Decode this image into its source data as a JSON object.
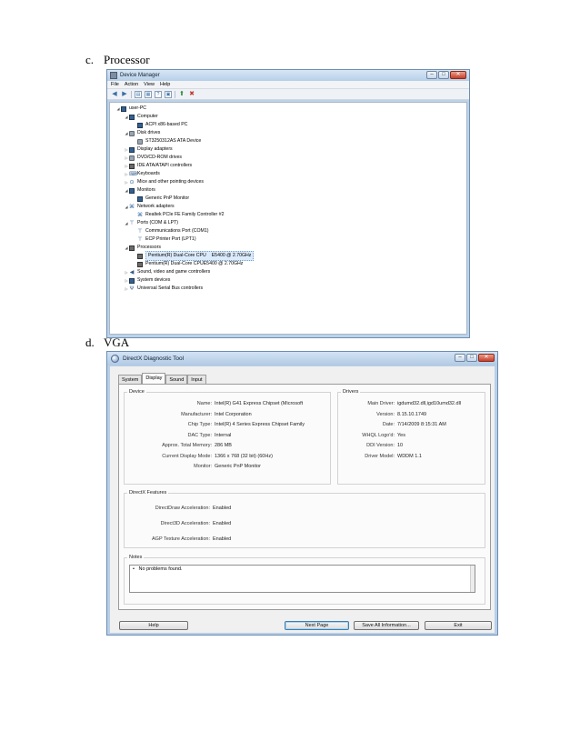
{
  "section_c": {
    "letter": "c.",
    "title": "Processor"
  },
  "section_d": {
    "letter": "d.",
    "title": "VGA"
  },
  "device_manager": {
    "window_title": "Device Manager",
    "menu": [
      "File",
      "Action",
      "View",
      "Help"
    ],
    "toolbar_icons": [
      "back-icon",
      "forward-icon",
      "properties-icon",
      "help-icon",
      "scan-icon",
      "update-driver-icon",
      "uninstall-icon"
    ],
    "tree": [
      {
        "label": "user-PC",
        "level": 0,
        "expander": "◢",
        "icon": "computer-icon"
      },
      {
        "label": "Computer",
        "level": 1,
        "expander": "◢",
        "icon": "monitor-icon"
      },
      {
        "label": "ACPI x86-based PC",
        "level": 2,
        "expander": "",
        "icon": "monitor-icon"
      },
      {
        "label": "Disk drives",
        "level": 1,
        "expander": "◢",
        "icon": "disk-icon"
      },
      {
        "label": "ST3250312AS ATA Device",
        "level": 2,
        "expander": "",
        "icon": "disk-icon"
      },
      {
        "label": "Display adapters",
        "level": 1,
        "expander": "▷",
        "icon": "monitor-icon"
      },
      {
        "label": "DVD/CD-ROM drives",
        "level": 1,
        "expander": "▷",
        "icon": "disk-icon"
      },
      {
        "label": "IDE ATA/ATAPI controllers",
        "level": 1,
        "expander": "▷",
        "icon": "chip-icon"
      },
      {
        "label": "Keyboards",
        "level": 1,
        "expander": "▷",
        "icon": "keyboard-icon"
      },
      {
        "label": "Mice and other pointing devices",
        "level": 1,
        "expander": "▷",
        "icon": "mouse-icon"
      },
      {
        "label": "Monitors",
        "level": 1,
        "expander": "◢",
        "icon": "monitor-icon"
      },
      {
        "label": "Generic PnP Monitor",
        "level": 2,
        "expander": "",
        "icon": "monitor-icon"
      },
      {
        "label": "Network adapters",
        "level": 1,
        "expander": "◢",
        "icon": "network-icon"
      },
      {
        "label": "Realtek PCIe FE Family Controller #2",
        "level": 2,
        "expander": "",
        "icon": "network-icon"
      },
      {
        "label": "Ports (COM & LPT)",
        "level": 1,
        "expander": "◢",
        "icon": "port-icon"
      },
      {
        "label": "Communications Port (COM1)",
        "level": 2,
        "expander": "",
        "icon": "port-icon"
      },
      {
        "label": "ECP Printer Port (LPT1)",
        "level": 2,
        "expander": "",
        "icon": "port-icon"
      },
      {
        "label": "Processors",
        "level": 1,
        "expander": "◢",
        "icon": "chip-icon"
      },
      {
        "label": "Pentium(R) Dual-Core  CPU",
        "label2": "E5400  @ 2.70GHz",
        "level": 2,
        "expander": "",
        "icon": "chip-icon",
        "selected": true
      },
      {
        "label": "Pentium(R) Dual-Core  CPU",
        "label2": "E5400  @ 2.70GHz",
        "level": 2,
        "expander": "",
        "icon": "chip-icon"
      },
      {
        "label": "Sound, video and game controllers",
        "level": 1,
        "expander": "▷",
        "icon": "speaker-icon"
      },
      {
        "label": "System devices",
        "level": 1,
        "expander": "▷",
        "icon": "monitor-icon"
      },
      {
        "label": "Universal Serial Bus controllers",
        "level": 1,
        "expander": "▷",
        "icon": "usb-icon"
      }
    ]
  },
  "directx": {
    "window_title": "DirectX Diagnostic Tool",
    "tabs": [
      "System",
      "Display",
      "Sound",
      "Input"
    ],
    "active_tab": "Display",
    "device": {
      "title": "Device",
      "rows": [
        {
          "k": "Name:",
          "v": "Intel(R) G41 Express Chipset (Microsoft"
        },
        {
          "k": "Manufacturer:",
          "v": "Intel Corporation"
        },
        {
          "k": "Chip Type:",
          "v": "Intel(R) 4 Series Express Chipset Family"
        },
        {
          "k": "DAC Type:",
          "v": "Internal"
        },
        {
          "k": "Approx. Total Memory:",
          "v": "286 MB"
        },
        {
          "k": "Current Display Mode:",
          "v": "1366 x 768 (32 bit) (60Hz)"
        },
        {
          "k": "Monitor:",
          "v": "Generic PnP Monitor"
        }
      ]
    },
    "drivers": {
      "title": "Drivers",
      "rows": [
        {
          "k": "Main Driver:",
          "v": "igdumd32.dll,igd10umd32.dll"
        },
        {
          "k": "Version:",
          "v": "8.15.10.1749"
        },
        {
          "k": "Date:",
          "v": "7/14/2009 8:15:31 AM"
        },
        {
          "k": "WHQL Logo'd:",
          "v": "Yes"
        },
        {
          "k": "DDI Version:",
          "v": "10"
        },
        {
          "k": "Driver Model:",
          "v": "WDDM 1.1"
        }
      ]
    },
    "features": {
      "title": "DirectX Features",
      "rows": [
        {
          "k": "DirectDraw Acceleration:",
          "v": "Enabled"
        },
        {
          "k": "Direct3D Acceleration:",
          "v": "Enabled"
        },
        {
          "k": "AGP Texture Acceleration:",
          "v": "Enabled"
        }
      ]
    },
    "notes": {
      "title": "Notes",
      "items": [
        "No problems found."
      ]
    },
    "buttons": {
      "help": "Help",
      "next_page": "Next Page",
      "save_all": "Save All Information...",
      "exit": "Exit"
    }
  }
}
